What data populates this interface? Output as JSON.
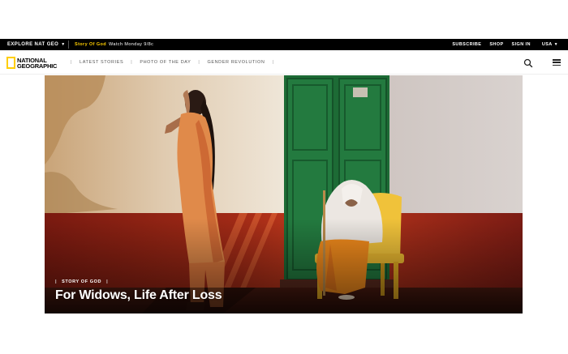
{
  "topbar": {
    "explore_label": "EXPLORE NAT GEO",
    "promo_show": "Story Of God",
    "promo_time": "Watch Monday 9/8c",
    "subscribe": "SUBSCRIBE",
    "shop": "SHOP",
    "signin": "SIGN IN",
    "region": "USA"
  },
  "logo": {
    "line1": "NATIONAL",
    "line2": "GEOGRAPHIC"
  },
  "nav": {
    "items": [
      {
        "label": "LATEST STORIES"
      },
      {
        "label": "PHOTO OF THE DAY"
      },
      {
        "label": "GENDER REVOLUTION"
      }
    ]
  },
  "hero": {
    "kicker": "STORY OF GOD",
    "headline": "For Widows, Life After Loss"
  },
  "colors": {
    "brand_yellow": "#ffce00",
    "topbar_bg": "#000000"
  },
  "icons": {
    "search": "search-icon",
    "menu": "hamburger-menu-icon",
    "caret": "caret-down-icon"
  }
}
